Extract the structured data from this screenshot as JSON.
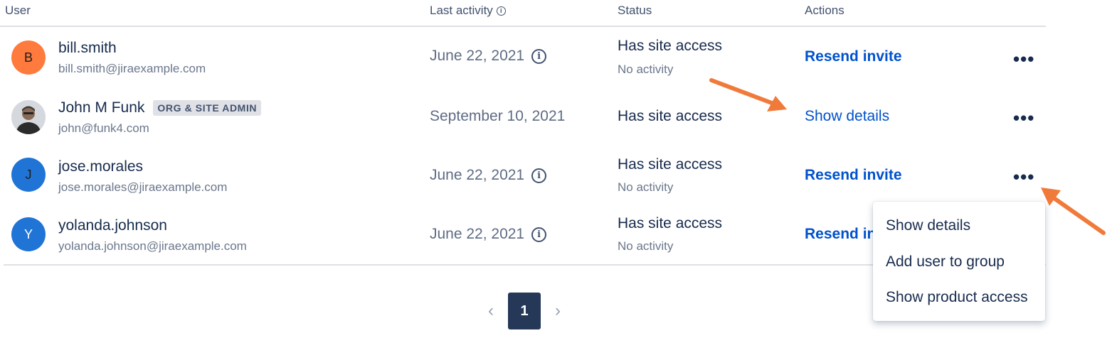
{
  "header": {
    "user": "User",
    "last_activity": "Last activity",
    "status": "Status",
    "actions": "Actions",
    "info_icon": "i"
  },
  "users": [
    {
      "initial": "B",
      "avatar_color": "#ff7a3d",
      "name": "bill.smith",
      "email": "bill.smith@jiraexample.com",
      "last_activity": "June 22, 2021",
      "status": "Has site access",
      "substatus": "No activity",
      "action": "Resend invite",
      "more": "•••"
    },
    {
      "initial": "",
      "avatar_color": "#cfd3d8",
      "name": "John M Funk",
      "badge": "ORG & SITE ADMIN",
      "email": "john@funk4.com",
      "last_activity": "September 10, 2021",
      "status": "Has site access",
      "action": "Show details",
      "more": "•••"
    },
    {
      "initial": "J",
      "avatar_color": "#1f74d6",
      "name": "jose.morales",
      "email": "jose.morales@jiraexample.com",
      "last_activity": "June 22, 2021",
      "status": "Has site access",
      "substatus": "No activity",
      "action": "Resend invite",
      "more": "•••"
    },
    {
      "initial": "Y",
      "avatar_color": "#1f74d6",
      "name": "yolanda.johnson",
      "email": "yolanda.johnson@jiraexample.com",
      "last_activity": "June 22, 2021",
      "status": "Has site access",
      "substatus": "No activity",
      "action": "Resend invite",
      "more": "•••"
    }
  ],
  "pagination": {
    "prev": "‹",
    "current": "1",
    "next": "›"
  },
  "menu": {
    "items": [
      "Show details",
      "Add user to group",
      "Show product access"
    ]
  },
  "colors": {
    "link": "#0052cc",
    "annotation_arrow": "#f07a3a",
    "pager_active": "#253858"
  }
}
